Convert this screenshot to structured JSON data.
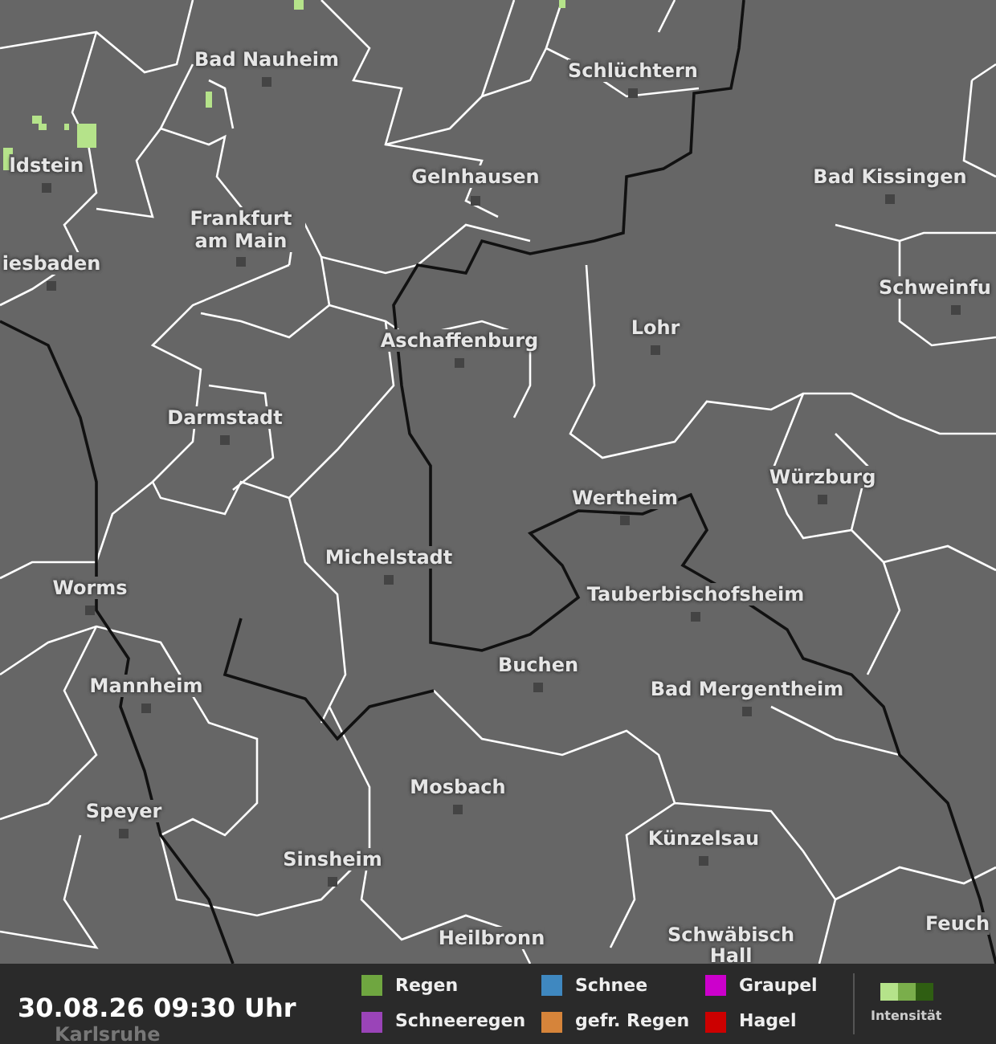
{
  "cities": [
    {
      "label": "Bad Nauheim"
    },
    {
      "label": "Schlüchtern"
    },
    {
      "label": "ldstein"
    },
    {
      "label": "Gelnhausen"
    },
    {
      "label": "Bad Kissingen"
    },
    {
      "label": "Frankfurt am Main"
    },
    {
      "label": "iesbaden"
    },
    {
      "label": "Schweinfu"
    },
    {
      "label": "Aschaffenburg"
    },
    {
      "label": "Lohr"
    },
    {
      "label": "Darmstadt"
    },
    {
      "label": "Würzburg"
    },
    {
      "label": "Wertheim"
    },
    {
      "label": "Michelstadt"
    },
    {
      "label": "Worms"
    },
    {
      "label": "Tauberbischofsheim"
    },
    {
      "label": "Buchen"
    },
    {
      "label": "Mannheim"
    },
    {
      "label": "Bad Mergentheim"
    },
    {
      "label": "Mosbach"
    },
    {
      "label": "Speyer"
    },
    {
      "label": "Künzelsau"
    },
    {
      "label": "Sinsheim"
    },
    {
      "label": "Feuch"
    },
    {
      "label": "Heilbronn"
    },
    {
      "label": "Schwäbisch Hall"
    },
    {
      "label": "Karlsruhe"
    }
  ],
  "legend": {
    "timestamp": "30.08.26 09:30 Uhr",
    "items": [
      {
        "label": "Regen",
        "color": "#6fa640"
      },
      {
        "label": "Schneeregen",
        "color": "#9a44b8"
      },
      {
        "label": "Schnee",
        "color": "#3f88c0"
      },
      {
        "label": "gefr. Regen",
        "color": "#d6843a"
      },
      {
        "label": "Graupel",
        "color": "#cc00cc"
      },
      {
        "label": "Hagel",
        "color": "#cc0000"
      }
    ],
    "intensity_scale": [
      {
        "color": "#b5e38a"
      },
      {
        "color": "#7aae4b"
      },
      {
        "color": "#2f5e12"
      }
    ],
    "intensity_label": "Intensität"
  }
}
